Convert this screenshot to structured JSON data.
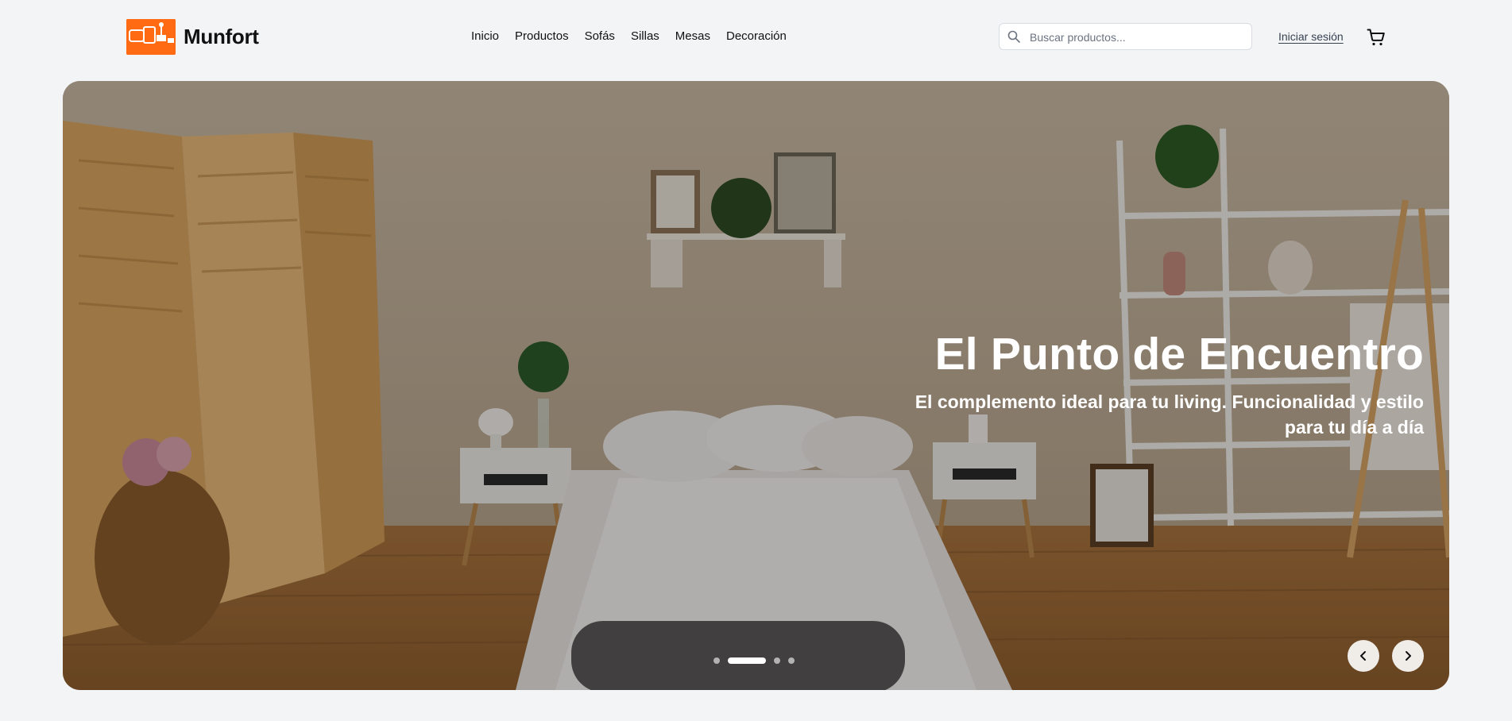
{
  "brand": {
    "name": "Munfort",
    "logo_icon": "furniture-logo-icon",
    "accent": "#ff6a13"
  },
  "nav": {
    "items": [
      {
        "label": "Inicio"
      },
      {
        "label": "Productos"
      },
      {
        "label": "Sofás"
      },
      {
        "label": "Sillas"
      },
      {
        "label": "Mesas"
      },
      {
        "label": "Decoración"
      }
    ]
  },
  "search": {
    "placeholder": "Buscar productos...",
    "value": "",
    "icon": "search-icon"
  },
  "account": {
    "login_label": "Iniciar sesión"
  },
  "cart": {
    "icon": "cart-icon"
  },
  "hero": {
    "title": "El Punto de Encuentro",
    "subtitle": "El complemento ideal para tu living. Funcionalidad y estilo para tu día a día",
    "image_alt": "bedroom-scene",
    "slides_total": 4,
    "active_slide": 2,
    "prev_icon": "chevron-left-icon",
    "next_icon": "chevron-right-icon"
  }
}
